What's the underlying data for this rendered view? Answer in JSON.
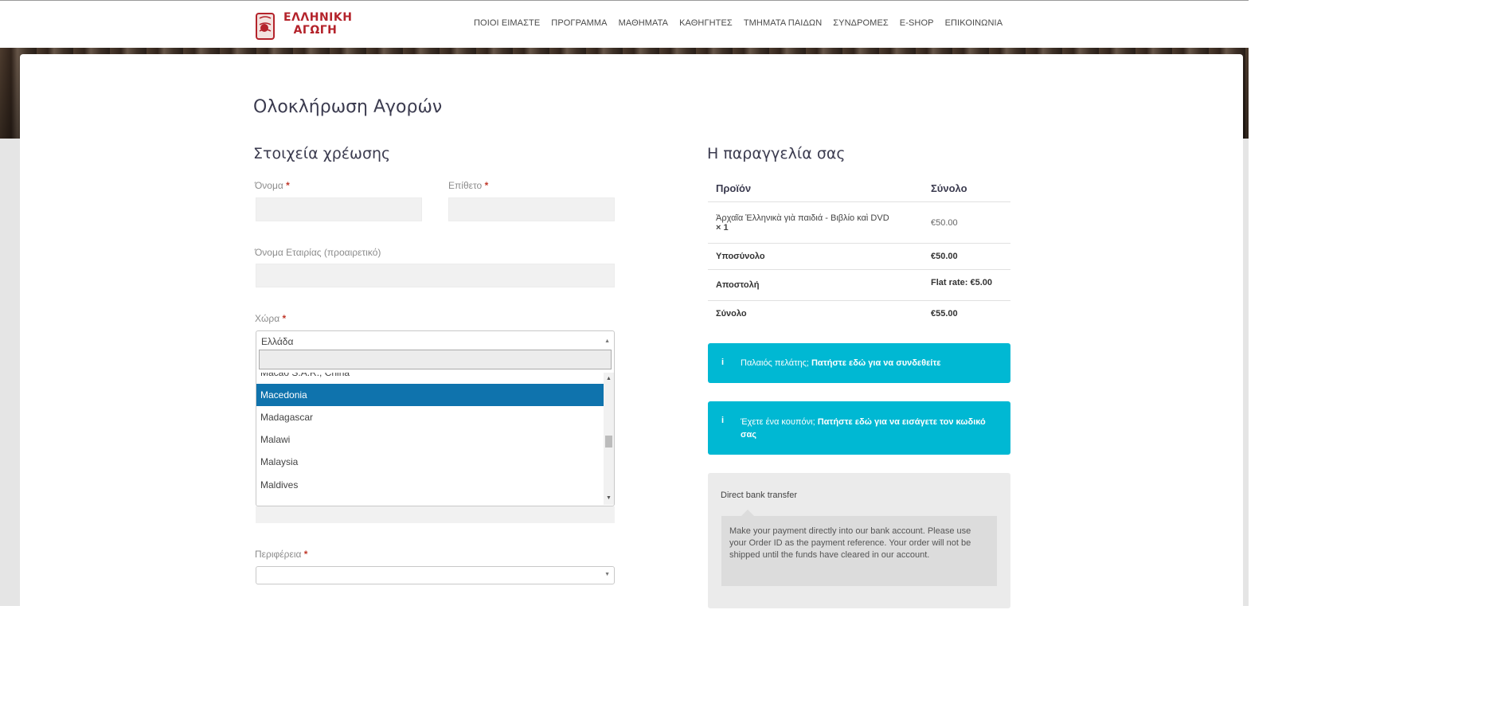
{
  "brand": {
    "logo_text": "ΕΛΛΗΝΙΚΗ ΑΓΩΓΗ",
    "color": "#b4232b"
  },
  "nav": [
    "ΠΟΙΟΙ ΕΙΜΑΣΤΕ",
    "ΠΡΟΓΡΑΜΜΑ",
    "ΜΑΘΗΜΑΤΑ",
    "ΚΑΘΗΓΗΤΕΣ",
    "ΤΜΗΜΑΤΑ ΠΑΙΔΩΝ",
    "ΣΥΝΔΡΟΜΕΣ",
    "E-SHOP",
    "ΕΠΙΚΟΙΝΩΝΙΑ"
  ],
  "page_title": "Ολοκλήρωση Αγορών",
  "billing": {
    "title": "Στοιχεία χρέωσης",
    "first_name_label": "Όνομα",
    "last_name_label": "Επίθετο",
    "company_label": "Όνομα Εταιρίας (προαιρετικό)",
    "country_label": "Χώρα",
    "country_value": "Ελλάδα",
    "region_label": "Περιφέρεια",
    "required_mark": "*"
  },
  "country_options": [
    {
      "label": "Macao S.A.R., China",
      "selected": false
    },
    {
      "label": "Macedonia",
      "selected": true
    },
    {
      "label": "Madagascar",
      "selected": false
    },
    {
      "label": "Malawi",
      "selected": false
    },
    {
      "label": "Malaysia",
      "selected": false
    },
    {
      "label": "Maldives",
      "selected": false
    }
  ],
  "order": {
    "title": "Η παραγγελία σας",
    "col_product": "Προϊόν",
    "col_total": "Σύνολο",
    "item_name": "Ἀρχαῖα Ἑλληνικὰ γιὰ παιδιά - Βιβλίο καὶ DVD",
    "item_qty": "× 1",
    "item_price": "€50.00",
    "subtotal_label": "Υποσύνολο",
    "subtotal_value": "€50.00",
    "shipping_label": "Αποστολή",
    "shipping_value": "Flat rate: €5.00",
    "total_label": "Σύνολο",
    "total_value": "€55.00"
  },
  "notices": {
    "login_prefix": "Παλαιός πελάτης;",
    "login_link": "Πατήστε εδώ για να συνδεθείτε",
    "coupon_prefix": "Έχετε ένα κουπόνι;",
    "coupon_link": "Πατήστε εδώ για να εισάγετε τον κωδικό σας",
    "icon": "i",
    "color": "#00b8d3"
  },
  "payment": {
    "method": "Direct bank transfer",
    "description": "Make your payment directly into our bank account. Please use your Order ID as the payment reference. Your order will not be shipped until the funds have cleared in our account."
  },
  "colors": {
    "selected_option": "#0f73ad",
    "required": "#c0392b"
  }
}
